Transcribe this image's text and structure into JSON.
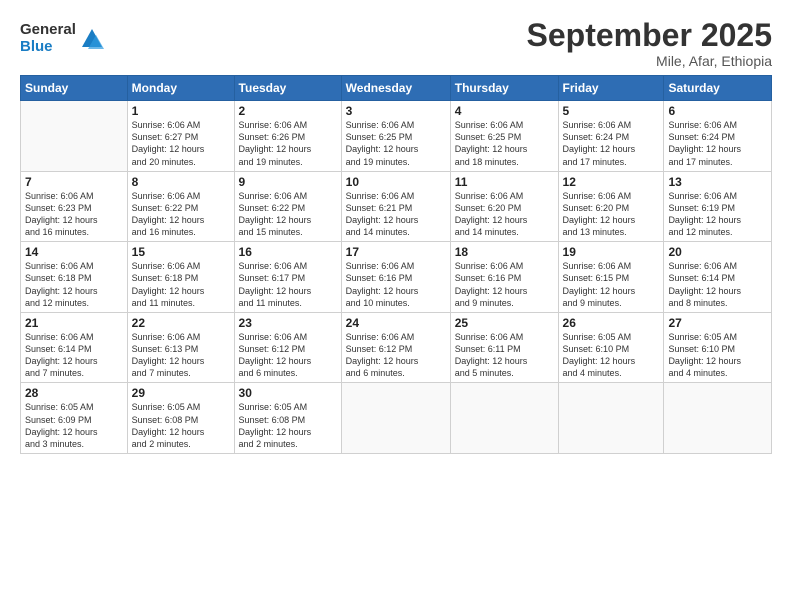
{
  "logo": {
    "general": "General",
    "blue": "Blue"
  },
  "title": "September 2025",
  "subtitle": "Mile, Afar, Ethiopia",
  "headers": [
    "Sunday",
    "Monday",
    "Tuesday",
    "Wednesday",
    "Thursday",
    "Friday",
    "Saturday"
  ],
  "weeks": [
    [
      {
        "num": "",
        "info": ""
      },
      {
        "num": "1",
        "info": "Sunrise: 6:06 AM\nSunset: 6:27 PM\nDaylight: 12 hours\nand 20 minutes."
      },
      {
        "num": "2",
        "info": "Sunrise: 6:06 AM\nSunset: 6:26 PM\nDaylight: 12 hours\nand 19 minutes."
      },
      {
        "num": "3",
        "info": "Sunrise: 6:06 AM\nSunset: 6:25 PM\nDaylight: 12 hours\nand 19 minutes."
      },
      {
        "num": "4",
        "info": "Sunrise: 6:06 AM\nSunset: 6:25 PM\nDaylight: 12 hours\nand 18 minutes."
      },
      {
        "num": "5",
        "info": "Sunrise: 6:06 AM\nSunset: 6:24 PM\nDaylight: 12 hours\nand 17 minutes."
      },
      {
        "num": "6",
        "info": "Sunrise: 6:06 AM\nSunset: 6:24 PM\nDaylight: 12 hours\nand 17 minutes."
      }
    ],
    [
      {
        "num": "7",
        "info": "Sunrise: 6:06 AM\nSunset: 6:23 PM\nDaylight: 12 hours\nand 16 minutes."
      },
      {
        "num": "8",
        "info": "Sunrise: 6:06 AM\nSunset: 6:22 PM\nDaylight: 12 hours\nand 16 minutes."
      },
      {
        "num": "9",
        "info": "Sunrise: 6:06 AM\nSunset: 6:22 PM\nDaylight: 12 hours\nand 15 minutes."
      },
      {
        "num": "10",
        "info": "Sunrise: 6:06 AM\nSunset: 6:21 PM\nDaylight: 12 hours\nand 14 minutes."
      },
      {
        "num": "11",
        "info": "Sunrise: 6:06 AM\nSunset: 6:20 PM\nDaylight: 12 hours\nand 14 minutes."
      },
      {
        "num": "12",
        "info": "Sunrise: 6:06 AM\nSunset: 6:20 PM\nDaylight: 12 hours\nand 13 minutes."
      },
      {
        "num": "13",
        "info": "Sunrise: 6:06 AM\nSunset: 6:19 PM\nDaylight: 12 hours\nand 12 minutes."
      }
    ],
    [
      {
        "num": "14",
        "info": "Sunrise: 6:06 AM\nSunset: 6:18 PM\nDaylight: 12 hours\nand 12 minutes."
      },
      {
        "num": "15",
        "info": "Sunrise: 6:06 AM\nSunset: 6:18 PM\nDaylight: 12 hours\nand 11 minutes."
      },
      {
        "num": "16",
        "info": "Sunrise: 6:06 AM\nSunset: 6:17 PM\nDaylight: 12 hours\nand 11 minutes."
      },
      {
        "num": "17",
        "info": "Sunrise: 6:06 AM\nSunset: 6:16 PM\nDaylight: 12 hours\nand 10 minutes."
      },
      {
        "num": "18",
        "info": "Sunrise: 6:06 AM\nSunset: 6:16 PM\nDaylight: 12 hours\nand 9 minutes."
      },
      {
        "num": "19",
        "info": "Sunrise: 6:06 AM\nSunset: 6:15 PM\nDaylight: 12 hours\nand 9 minutes."
      },
      {
        "num": "20",
        "info": "Sunrise: 6:06 AM\nSunset: 6:14 PM\nDaylight: 12 hours\nand 8 minutes."
      }
    ],
    [
      {
        "num": "21",
        "info": "Sunrise: 6:06 AM\nSunset: 6:14 PM\nDaylight: 12 hours\nand 7 minutes."
      },
      {
        "num": "22",
        "info": "Sunrise: 6:06 AM\nSunset: 6:13 PM\nDaylight: 12 hours\nand 7 minutes."
      },
      {
        "num": "23",
        "info": "Sunrise: 6:06 AM\nSunset: 6:12 PM\nDaylight: 12 hours\nand 6 minutes."
      },
      {
        "num": "24",
        "info": "Sunrise: 6:06 AM\nSunset: 6:12 PM\nDaylight: 12 hours\nand 6 minutes."
      },
      {
        "num": "25",
        "info": "Sunrise: 6:06 AM\nSunset: 6:11 PM\nDaylight: 12 hours\nand 5 minutes."
      },
      {
        "num": "26",
        "info": "Sunrise: 6:05 AM\nSunset: 6:10 PM\nDaylight: 12 hours\nand 4 minutes."
      },
      {
        "num": "27",
        "info": "Sunrise: 6:05 AM\nSunset: 6:10 PM\nDaylight: 12 hours\nand 4 minutes."
      }
    ],
    [
      {
        "num": "28",
        "info": "Sunrise: 6:05 AM\nSunset: 6:09 PM\nDaylight: 12 hours\nand 3 minutes."
      },
      {
        "num": "29",
        "info": "Sunrise: 6:05 AM\nSunset: 6:08 PM\nDaylight: 12 hours\nand 2 minutes."
      },
      {
        "num": "30",
        "info": "Sunrise: 6:05 AM\nSunset: 6:08 PM\nDaylight: 12 hours\nand 2 minutes."
      },
      {
        "num": "",
        "info": ""
      },
      {
        "num": "",
        "info": ""
      },
      {
        "num": "",
        "info": ""
      },
      {
        "num": "",
        "info": ""
      }
    ]
  ]
}
